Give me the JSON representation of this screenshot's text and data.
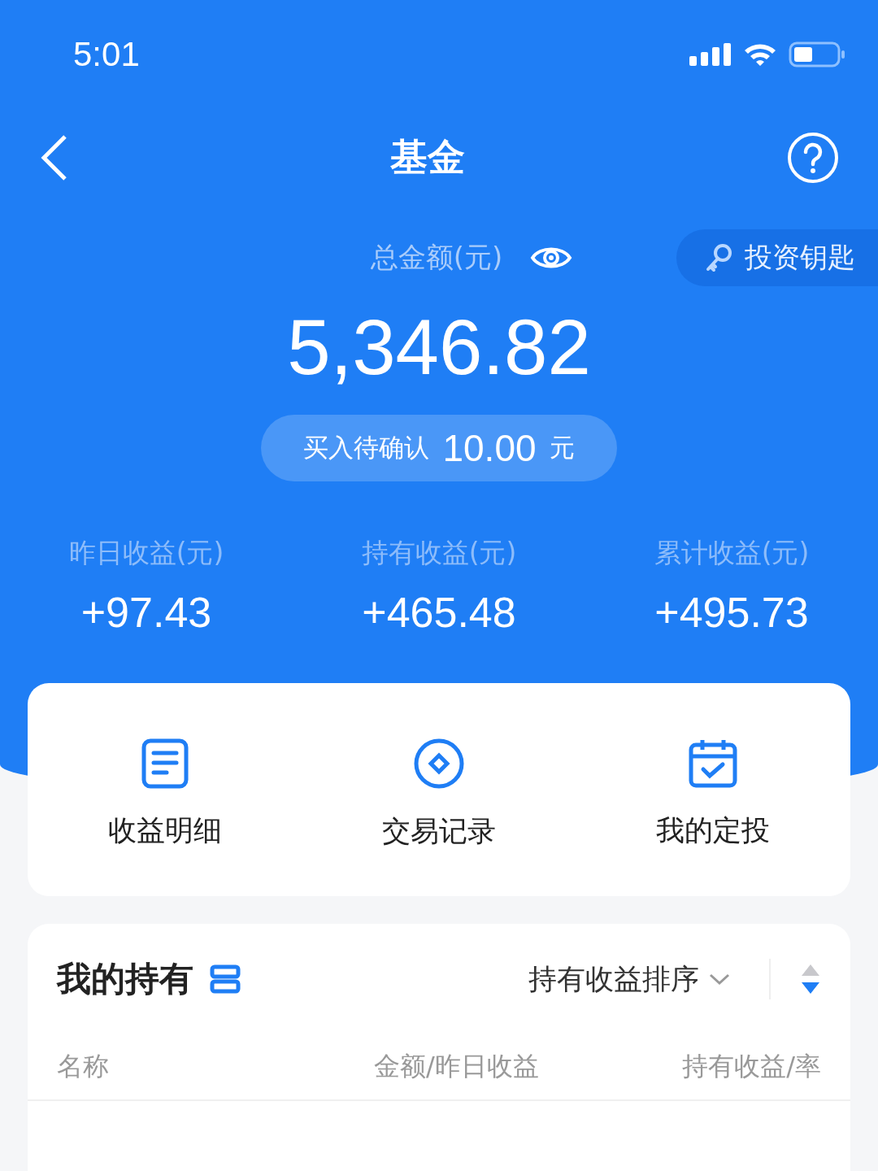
{
  "status_bar": {
    "time": "5:01"
  },
  "nav": {
    "title": "基金"
  },
  "summary": {
    "label": "总金额(元)",
    "amount": "5,346.82",
    "key_button": "投资钥匙",
    "pending": {
      "label": "买入待确认",
      "amount": "10.00",
      "unit": "元"
    }
  },
  "stats": [
    {
      "label": "昨日收益(元)",
      "value": "+97.43"
    },
    {
      "label": "持有收益(元)",
      "value": "+465.48"
    },
    {
      "label": "累计收益(元)",
      "value": "+495.73"
    }
  ],
  "shortcuts": [
    {
      "kind": "document",
      "label": "收益明细"
    },
    {
      "kind": "diamond",
      "label": "交易记录"
    },
    {
      "kind": "calendar",
      "label": "我的定投"
    }
  ],
  "holdings": {
    "title": "我的持有",
    "sort": "持有收益排序",
    "sort_descending": true,
    "columns": [
      "名称",
      "金额/昨日收益",
      "持有收益/率"
    ]
  }
}
